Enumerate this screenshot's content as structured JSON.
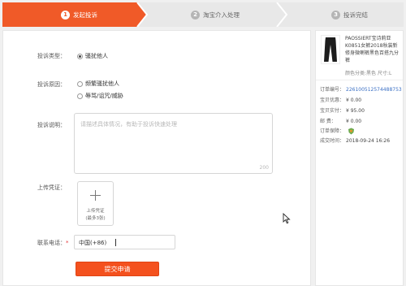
{
  "steps": [
    {
      "num": "1",
      "label": "发起投诉"
    },
    {
      "num": "2",
      "label": "淘宝介入处理"
    },
    {
      "num": "3",
      "label": "投诉完结"
    }
  ],
  "form": {
    "type_label": "投诉类型：",
    "type_options": [
      "骚扰他人"
    ],
    "reason_label": "投诉原因：",
    "reason_options": [
      "频繁骚扰他人",
      "辱骂/诅咒/威胁"
    ],
    "desc_label": "投诉说明：",
    "desc_placeholder": "请描述具体情况，有助于投诉快速处理",
    "desc_counter": "200",
    "proof_label": "上传凭证：",
    "upload_line1": "上传凭证",
    "upload_line2": "(最多3张)",
    "phone_label": "联系电话：",
    "phone_required_mark": "*",
    "phone_prefix": "中国(+86)",
    "submit_label": "提交申请"
  },
  "order": {
    "title": "PAOSSIERT宝诗莉亚K0851女裤2018秋装新修身微喇裤黑色百搭九分裤",
    "attr": "颜色分类:黑色   尺寸:L",
    "rows": [
      {
        "key": "订单编号：",
        "value": "226100512574488753"
      },
      {
        "key": "宝贝优惠：",
        "value": "¥ 0.00"
      },
      {
        "key": "宝贝实付：",
        "value": "¥ 95.00"
      },
      {
        "key": "邮 费：",
        "value": "¥ 0.00"
      },
      {
        "key": "订单保障：",
        "value": ""
      },
      {
        "key": "成交时间：",
        "value": "2018-09-24 16:26"
      }
    ]
  },
  "colors": {
    "accent": "#f4511e",
    "step_active": "#f05a28",
    "step_inactive": "#e8e8e8",
    "link": "#3a6fc4"
  }
}
